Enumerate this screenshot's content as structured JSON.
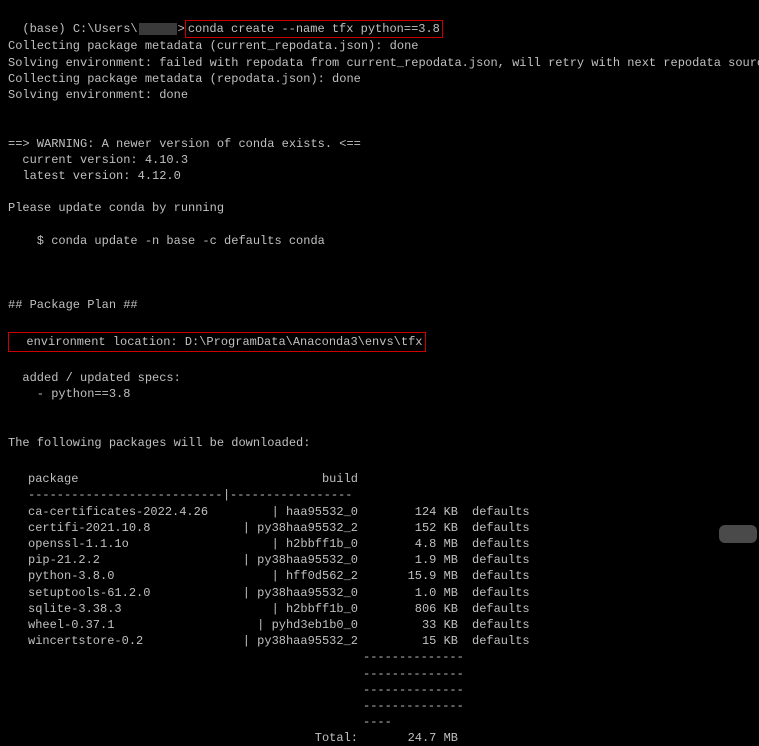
{
  "prompt": {
    "prefix": "(base) C:\\Users\\",
    "suffix": ">",
    "command": "conda create --name tfx python==3.8"
  },
  "output": {
    "line_collecting1": "Collecting package metadata (current_repodata.json): done",
    "line_solving_fail": "Solving environment: failed with repodata from current_repodata.json, will retry with next repodata source.",
    "line_collecting2": "Collecting package metadata (repodata.json): done",
    "line_solving_done": "Solving environment: done",
    "warn_header": "==> WARNING: A newer version of conda exists. <==",
    "warn_current": "  current version: 4.10.3",
    "warn_latest": "  latest version: 4.12.0",
    "update_prompt": "Please update conda by running",
    "update_cmd": "    $ conda update -n base -c defaults conda",
    "plan_header": "## Package Plan ##",
    "env_location": "  environment location: D:\\ProgramData\\Anaconda3\\envs\\tfx",
    "added_updated": "  added / updated specs:",
    "spec_item": "    - python==3.8",
    "download_header": "The following packages will be downloaded:"
  },
  "packages": {
    "header_pkg": "package",
    "header_build": "build",
    "sep_dash": "---------------------------|-----------------",
    "rows": [
      {
        "name": "ca-certificates-2022.4.26",
        "build": "haa95532_0",
        "size": "124 KB",
        "channel": "defaults"
      },
      {
        "name": "certifi-2021.10.8",
        "build": "py38haa95532_2",
        "size": "152 KB",
        "channel": "defaults"
      },
      {
        "name": "openssl-1.1.1o",
        "build": "h2bbff1b_0",
        "size": "4.8 MB",
        "channel": "defaults"
      },
      {
        "name": "pip-21.2.2",
        "build": "py38haa95532_0",
        "size": "1.9 MB",
        "channel": "defaults"
      },
      {
        "name": "python-3.8.0",
        "build": "hff0d562_2",
        "size": "15.9 MB",
        "channel": "defaults"
      },
      {
        "name": "setuptools-61.2.0",
        "build": "py38haa95532_0",
        "size": "1.0 MB",
        "channel": "defaults"
      },
      {
        "name": "sqlite-3.38.3",
        "build": "h2bbff1b_0",
        "size": "806 KB",
        "channel": "defaults"
      },
      {
        "name": "wheel-0.37.1",
        "build": "pyhd3eb1b0_0",
        "size": "33 KB",
        "channel": "defaults"
      },
      {
        "name": "wincertstore-0.2",
        "build": "py38haa95532_2",
        "size": "15 KB",
        "channel": "defaults"
      }
    ],
    "total_label": "Total:",
    "total_value": "24.7 MB"
  }
}
